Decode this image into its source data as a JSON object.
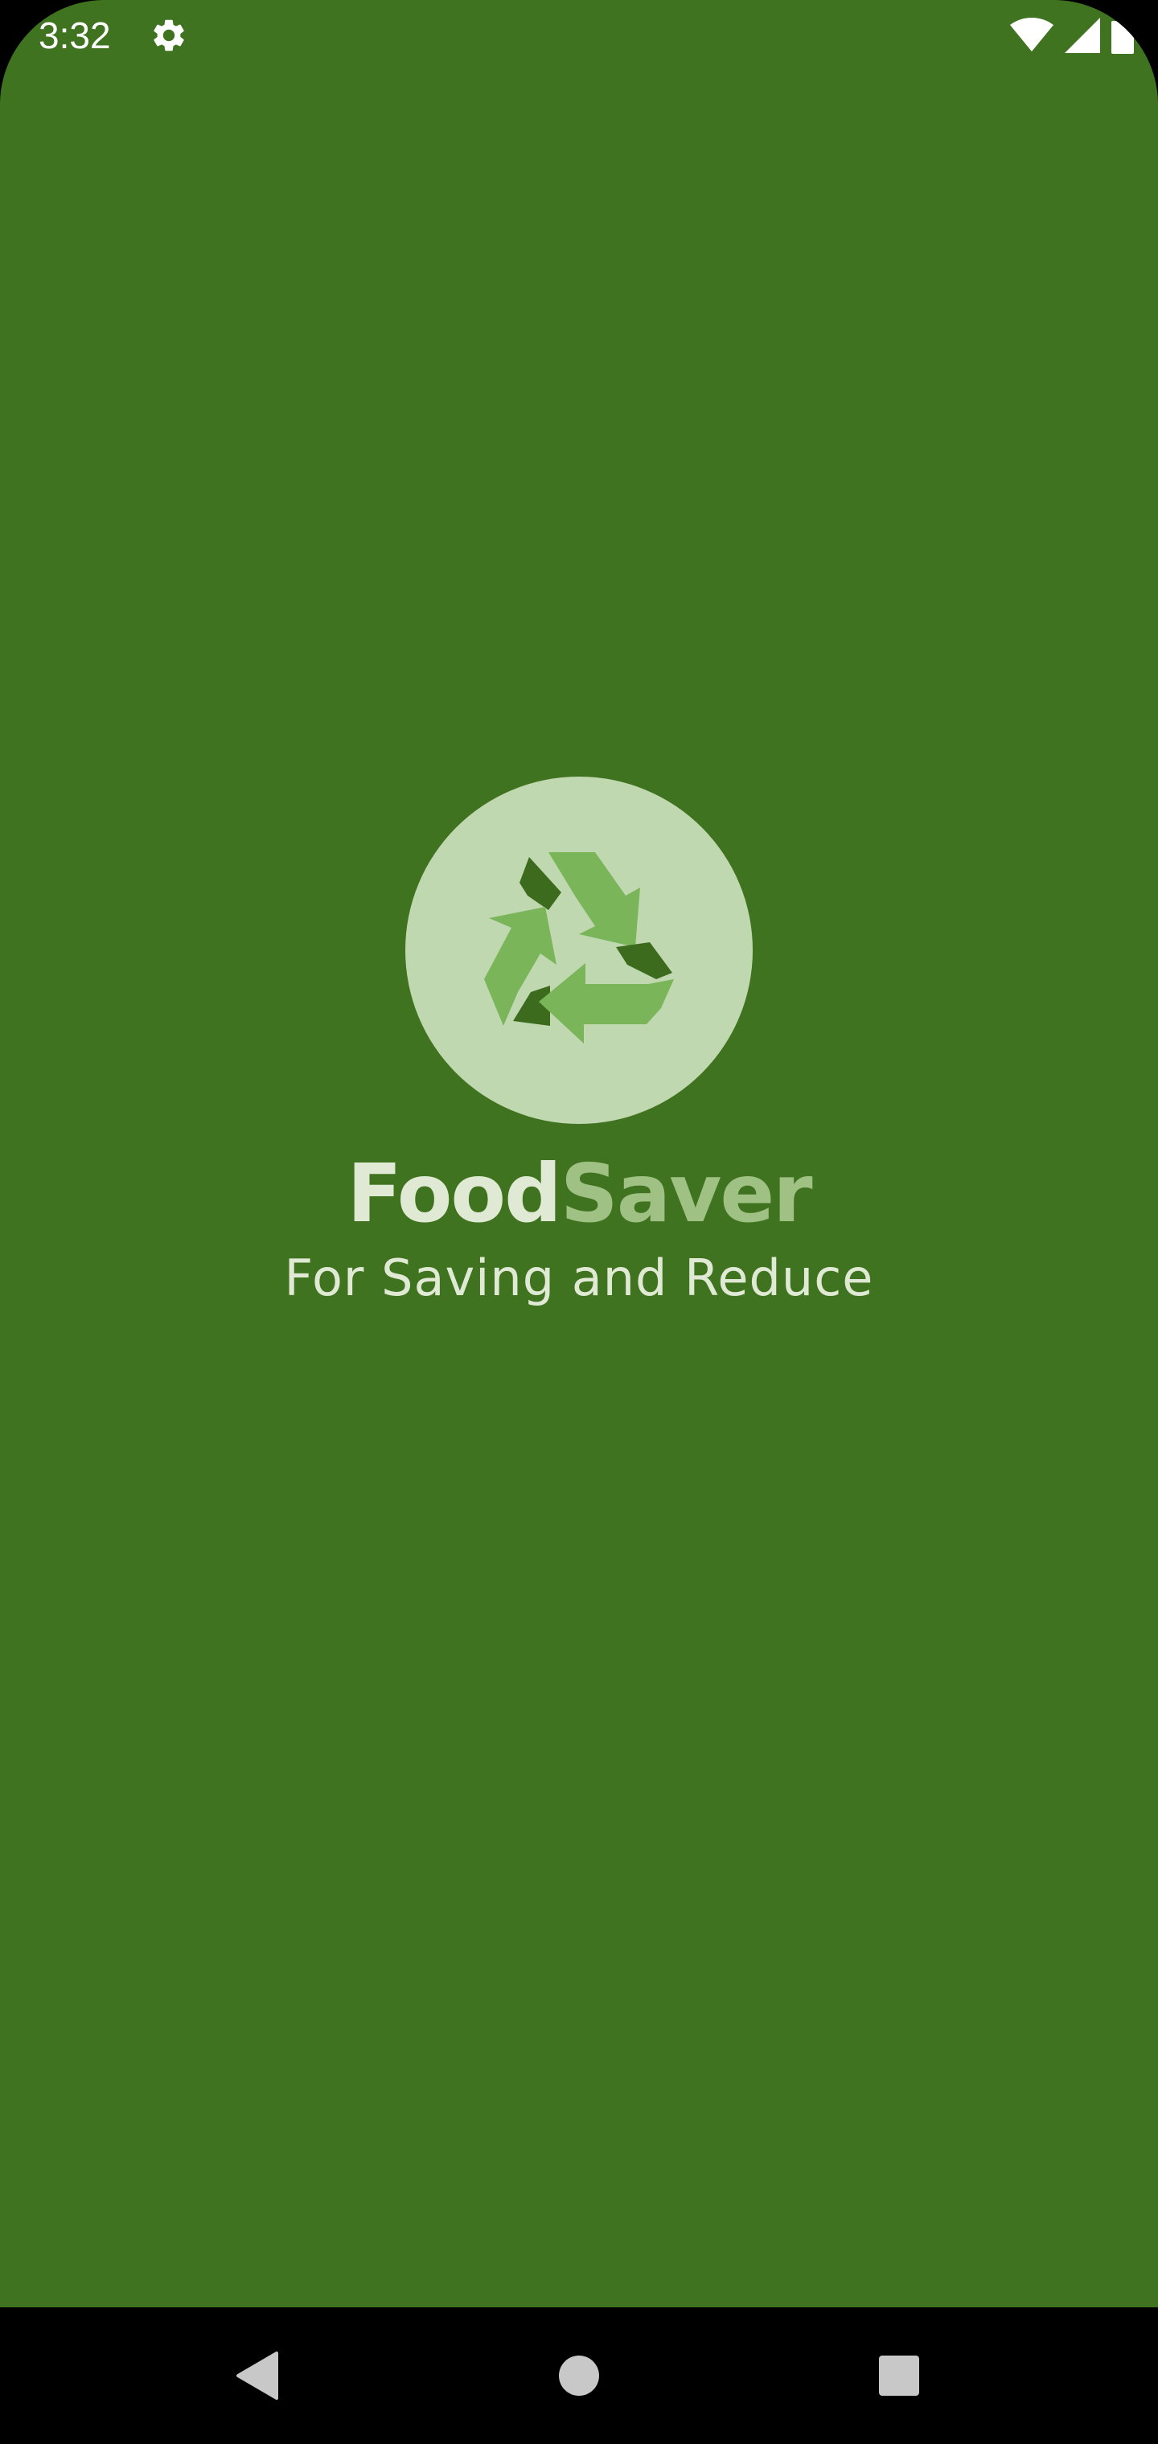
{
  "status_bar": {
    "time": "3:32",
    "settings_icon": "gear-icon",
    "wifi_icon": "wifi-icon",
    "signal_icon": "cell-signal-icon",
    "battery_icon": "battery-icon"
  },
  "splash": {
    "logo_icon": "recycle-icon",
    "brand_part1": "Food",
    "brand_part2": "Saver",
    "tagline": "For Saving and Reduce"
  },
  "nav_bar": {
    "back_icon": "back-triangle-icon",
    "home_icon": "home-circle-icon",
    "recents_icon": "recents-square-icon"
  },
  "colors": {
    "background": "#40731f",
    "logo_circle": "#c0d8b0",
    "arrow_light": "#7ab55a",
    "arrow_dark": "#3d6b1e",
    "brand_primary": "#dfe9d3",
    "brand_secondary": "#9fc184"
  }
}
